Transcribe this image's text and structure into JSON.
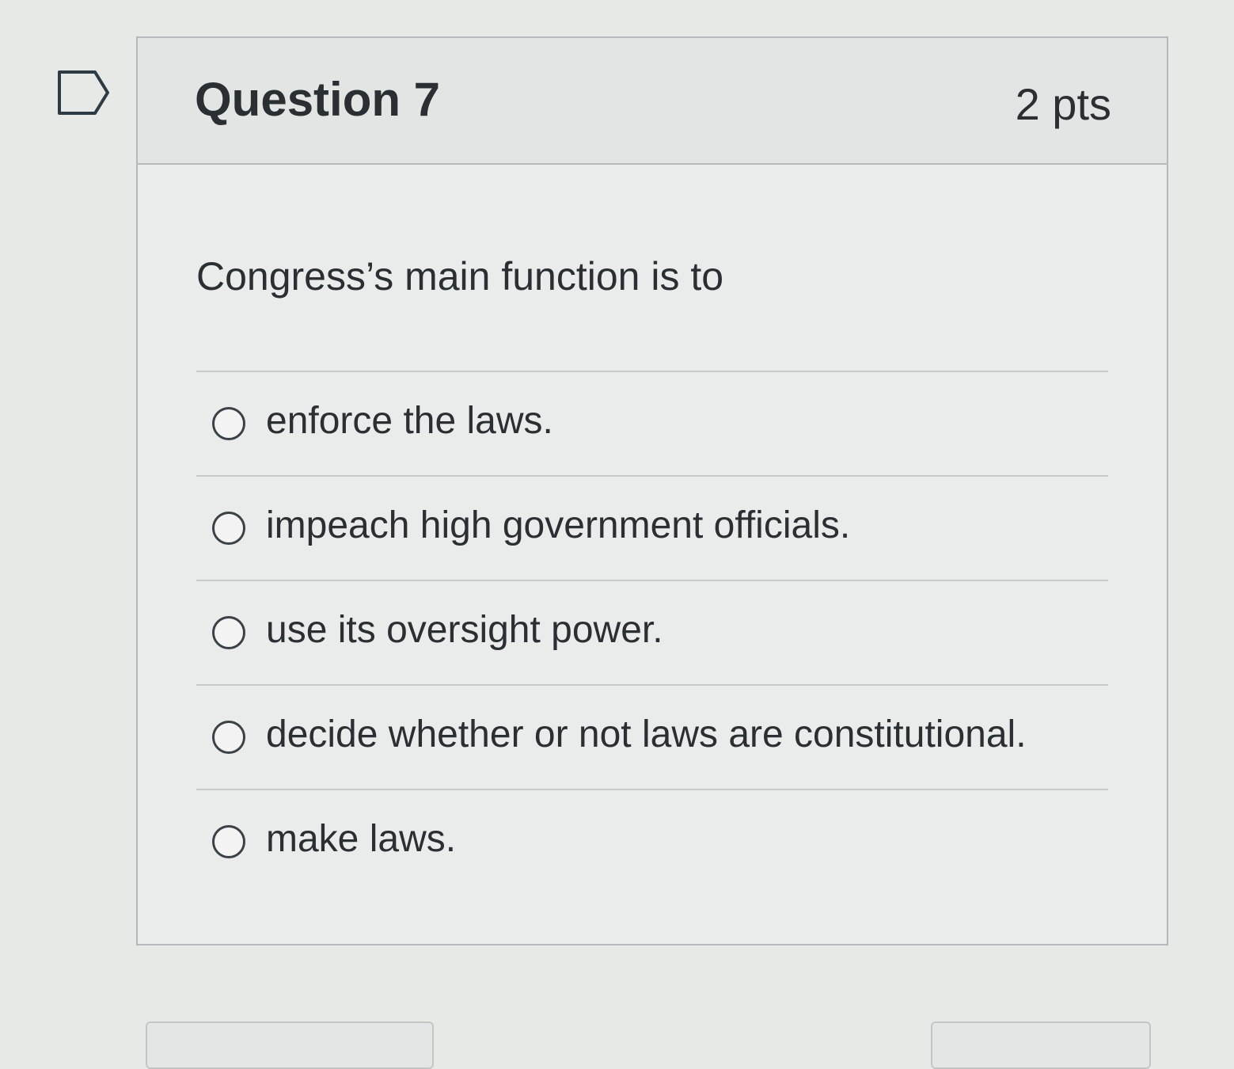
{
  "question": {
    "title": "Question 7",
    "points": "2 pts",
    "text": "Congress’s main function is to",
    "flag_icon": "bookmark-flag-icon"
  },
  "answers": [
    {
      "label": "enforce the laws.",
      "selected": false
    },
    {
      "label": "impeach high government officials.",
      "selected": false
    },
    {
      "label": "use its oversight power.",
      "selected": false
    },
    {
      "label": "decide whether or not laws are constitutional.",
      "selected": false
    },
    {
      "label": "make laws.",
      "selected": false
    }
  ],
  "footer": {
    "previous_label": "",
    "next_label": ""
  }
}
